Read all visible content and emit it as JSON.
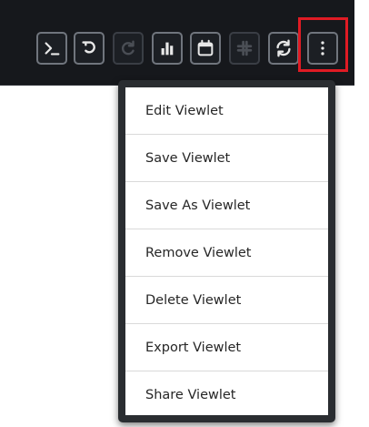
{
  "toolbar": {
    "buttons": [
      {
        "name": "terminal-icon",
        "enabled": true
      },
      {
        "name": "undo-icon",
        "enabled": true
      },
      {
        "name": "redo-icon",
        "enabled": false
      },
      {
        "name": "bar-chart-icon",
        "enabled": true
      },
      {
        "name": "calendar-icon",
        "enabled": true
      },
      {
        "name": "slack-icon",
        "enabled": false
      },
      {
        "name": "refresh-icon",
        "enabled": true
      },
      {
        "name": "more-vertical-icon",
        "enabled": true
      }
    ],
    "highlight_color": "#e01b24"
  },
  "menu": {
    "items": [
      {
        "label": "Edit Viewlet"
      },
      {
        "label": "Save Viewlet"
      },
      {
        "label": "Save As Viewlet"
      },
      {
        "label": "Remove Viewlet"
      },
      {
        "label": "Delete Viewlet"
      },
      {
        "label": "Export Viewlet"
      },
      {
        "label": "Share Viewlet"
      }
    ]
  },
  "colors": {
    "toolbar_background": "#16181c",
    "icon": "#e8e8e8",
    "icon_disabled": "#4a4e55",
    "menu_border": "#2a2d31"
  }
}
